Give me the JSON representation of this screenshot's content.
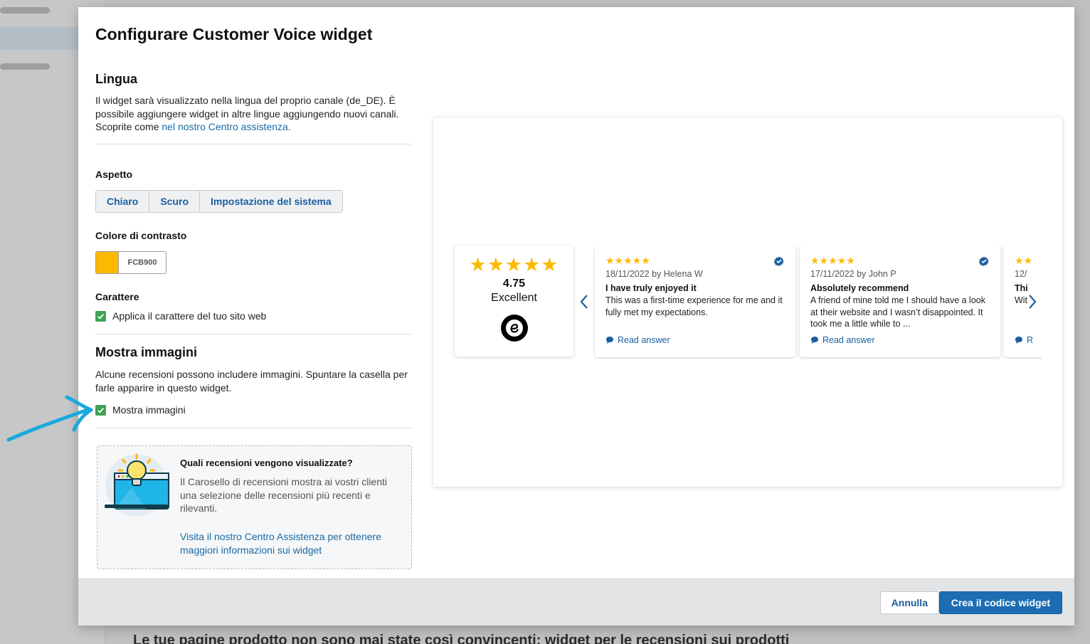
{
  "background": {
    "heading": "Le tue pagine prodotto non sono mai state così convincenti: widget per le recensioni sui prodotti"
  },
  "modal": {
    "title": "Configurare Customer Voice widget",
    "language": {
      "heading": "Lingua",
      "text": "Il widget sarà visualizzato nella lingua del proprio canale (de_DE). È possibile aggiungere widget in altre lingue aggiungendo nuovi canali. Scoprite come ",
      "link": "nel nostro Centro assistenza."
    },
    "appearance": {
      "heading": "Aspetto",
      "options": [
        "Chiaro",
        "Scuro",
        "Impostazione del sistema"
      ]
    },
    "contrast": {
      "heading": "Colore di contrasto",
      "hex": "FCB900",
      "color": "#FCB900"
    },
    "font": {
      "heading": "Carattere",
      "checkbox_label": "Applica il carattere del tuo sito web"
    },
    "images": {
      "heading": "Mostra immagini",
      "text": "Alcune recensioni possono includere immagini. Spuntare la casella per farle apparire in questo widget.",
      "checkbox_label": "Mostra immagini"
    },
    "info": {
      "title": "Quali recensioni vengono visualizzate?",
      "text": "Il Carosello di recensioni mostra ai vostri clienti una selezione delle recensioni più recenti e rilevanti.",
      "link": "Visita il nostro Centro Assistenza per ottenere maggiori informazioni sui widget"
    },
    "footer": {
      "cancel": "Annulla",
      "create": "Crea il codice widget"
    }
  },
  "preview": {
    "summary": {
      "stars": "★★★★★",
      "score": "4.75",
      "label": "Excellent"
    },
    "cards": [
      {
        "stars": "★★★★★",
        "meta": "18/11/2022 by Helena W",
        "title": "I have truly enjoyed it",
        "body": "This was a first-time experience for me and it fully met my expectations.",
        "answer": "Read answer"
      },
      {
        "stars": "★★★★★",
        "meta": "17/11/2022 by John P",
        "title": "Absolutely recommend",
        "body": "A friend of mine told me I should have a look at their website and I wasn’t disappointed. It took me a little while to ...",
        "answer": "Read answer"
      },
      {
        "stars": "★★",
        "meta": "12/",
        "title": "Thi",
        "body": "Wit",
        "answer": "R"
      }
    ]
  },
  "colors": {
    "accent": "#FCB900",
    "primary": "#1d6db3",
    "link": "#1b6aa5",
    "check": "#3fa355",
    "annotation_arrow": "#1aa9dc"
  }
}
